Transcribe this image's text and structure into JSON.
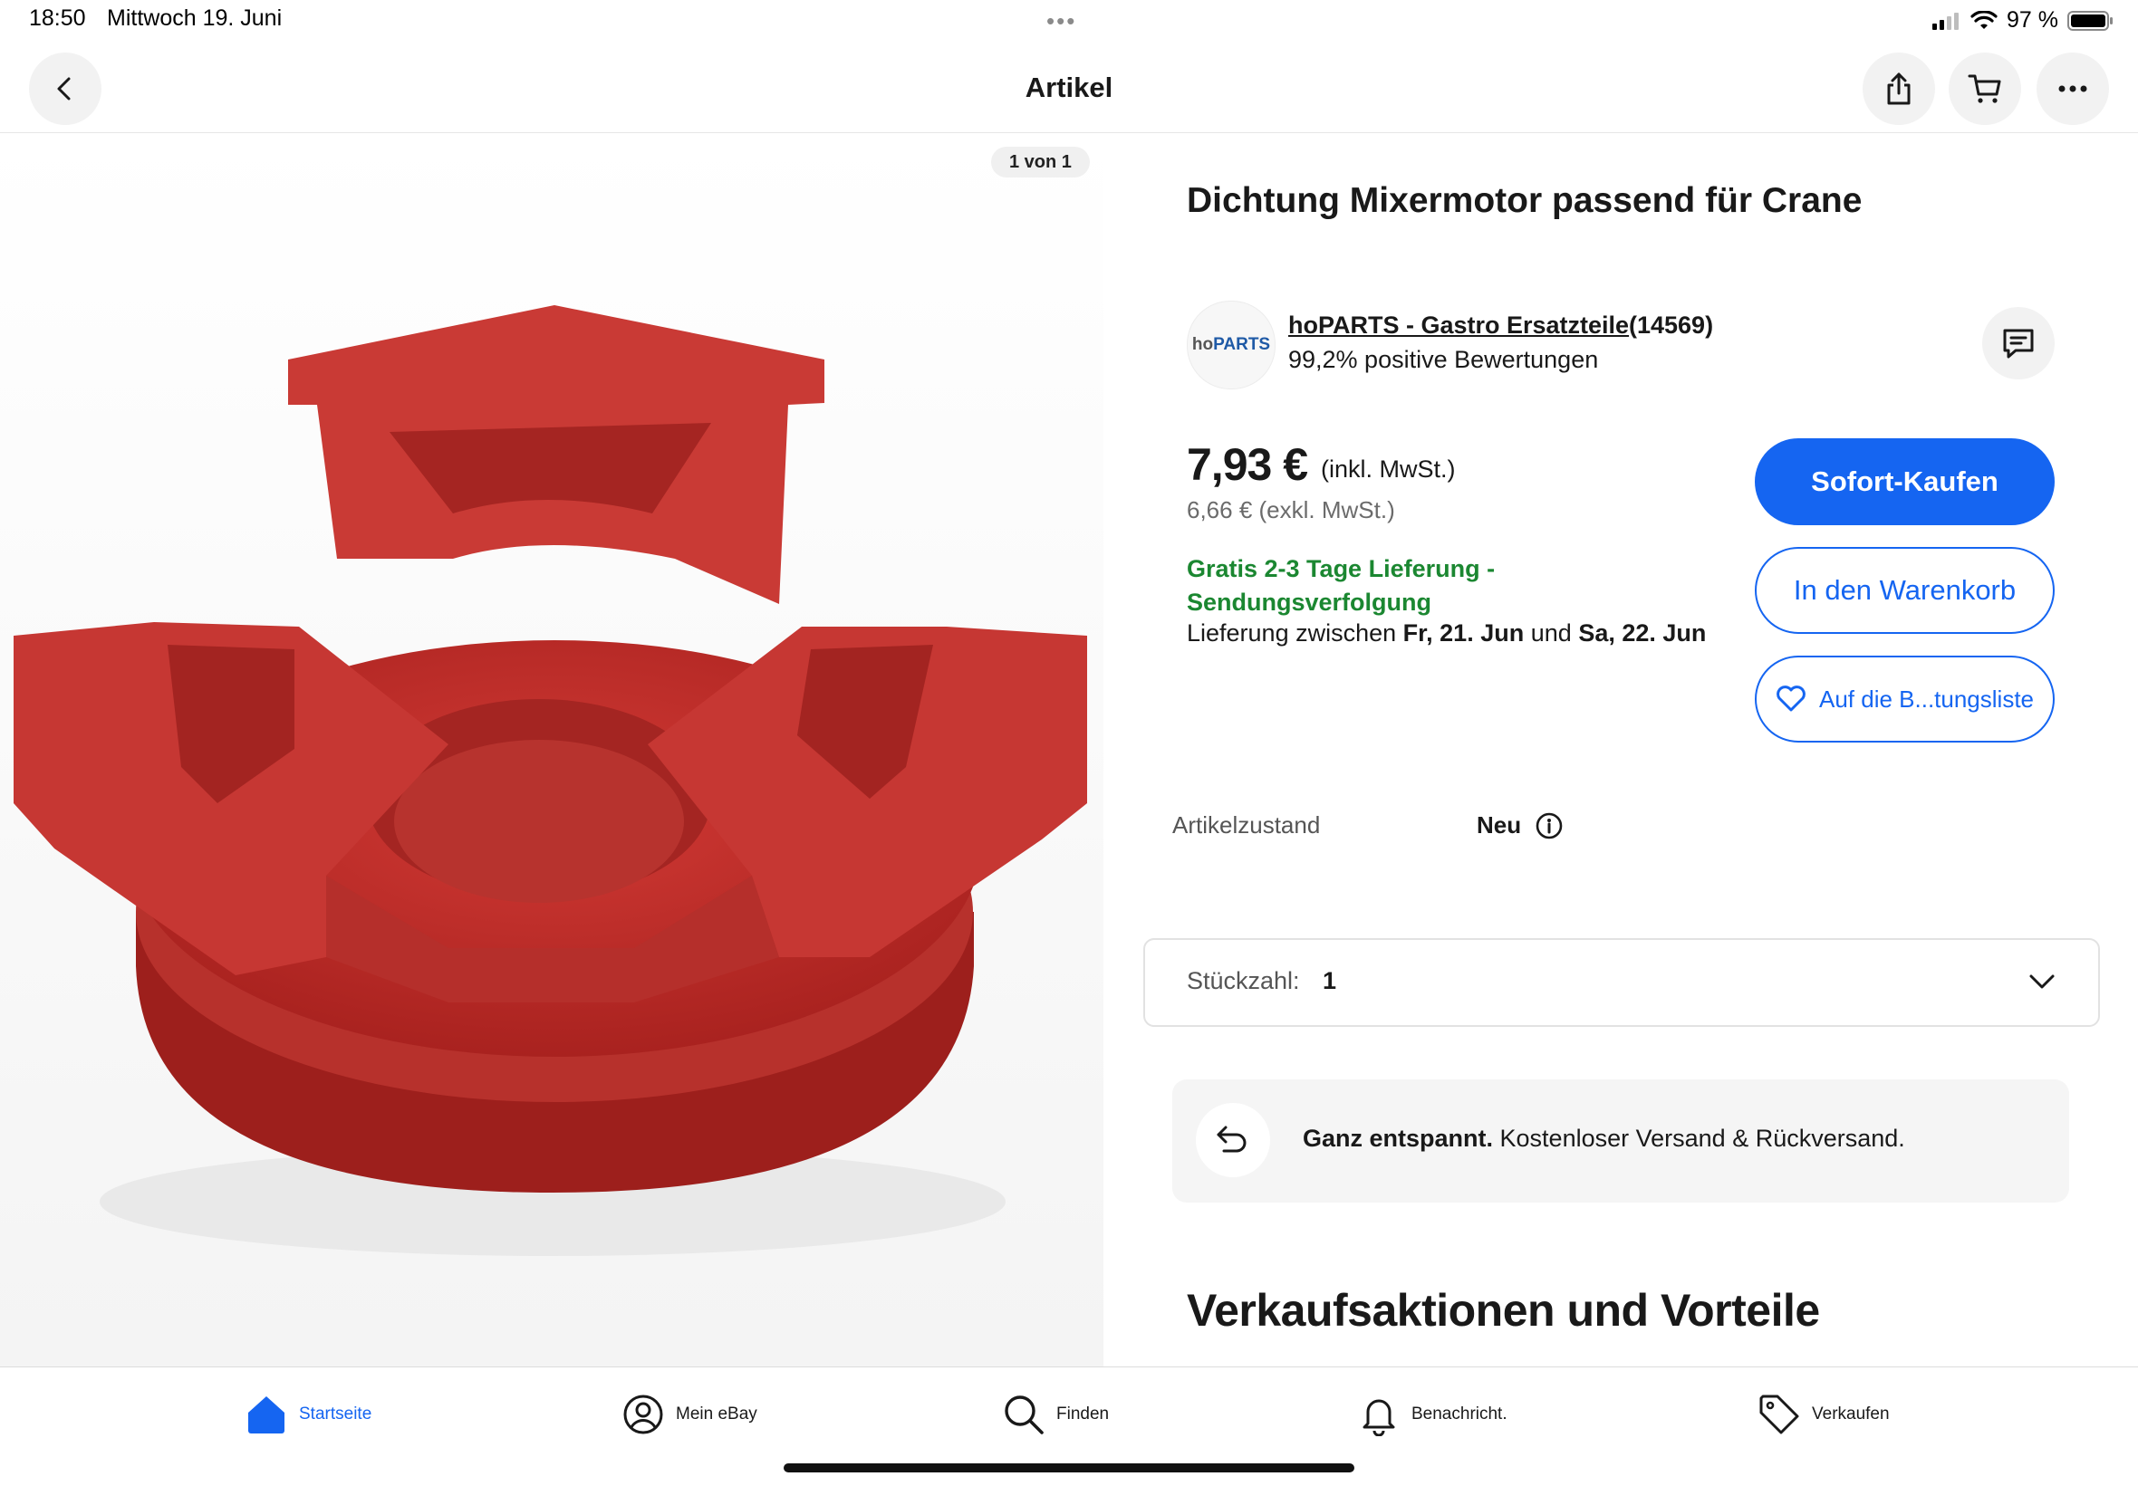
{
  "status_bar": {
    "time": "18:50",
    "date": "Mittwoch 19. Juni",
    "battery_percent": "97 %",
    "icons": [
      "signal-icon",
      "wifi-icon",
      "battery-icon"
    ]
  },
  "nav": {
    "title": "Artikel",
    "icons": [
      "back-icon",
      "share-icon",
      "cart-icon",
      "more-icon"
    ]
  },
  "image": {
    "counter": "1 von 1",
    "description_icon": "product-photo"
  },
  "product": {
    "title": "Dichtung Mixermotor passend für Crane"
  },
  "seller": {
    "logo_text_ho": "ho",
    "logo_text_parts": "PARTS",
    "name": "hoPARTS - Gastro Ersatzteile",
    "count": "(14569)",
    "rating": "99,2% positive Bewertungen"
  },
  "price": {
    "main": "7,93 €",
    "incl": "(inkl. MwSt.)",
    "net": "6,66 € (exkl. MwSt.)"
  },
  "shipping": {
    "headline": "Gratis 2-3 Tage Lieferung - Sendungsverfolgung",
    "delivery_prefix": "Lieferung zwischen",
    "date_from": "Fr, 21. Jun",
    "delivery_and": "und",
    "date_to": "Sa, 22. Jun"
  },
  "buttons": {
    "buy_now": "Sofort-Kaufen",
    "add_to_cart": "In den Warenkorb",
    "watchlist": "Auf die B...tungsliste"
  },
  "condition": {
    "label": "Artikelzustand",
    "value": "Neu"
  },
  "quantity": {
    "label": "Stückzahl:",
    "value": "1"
  },
  "returns": {
    "bold": "Ganz entspannt.",
    "text": "Kostenloser Versand & Rückversand."
  },
  "section": {
    "heading": "Verkaufsaktionen und Vorteile"
  },
  "tabs": [
    {
      "label": "Startseite",
      "icon": "home-icon",
      "active": true
    },
    {
      "label": "Mein eBay",
      "icon": "user-icon",
      "active": false
    },
    {
      "label": "Finden",
      "icon": "search-icon",
      "active": false
    },
    {
      "label": "Benachricht.",
      "icon": "bell-icon",
      "active": false
    },
    {
      "label": "Verkaufen",
      "icon": "tag-icon",
      "active": false
    }
  ],
  "colors": {
    "accent": "#1565f1",
    "green": "#1b8731",
    "product_red": "#c0302d"
  }
}
